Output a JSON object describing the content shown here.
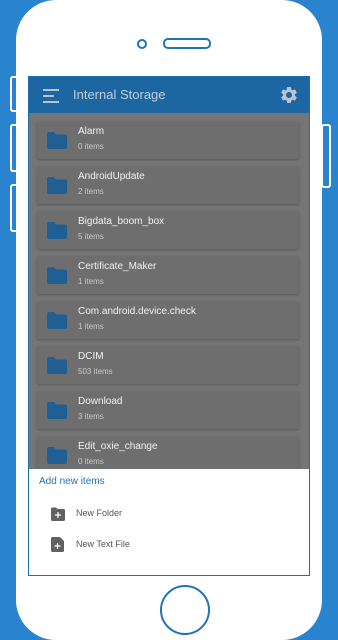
{
  "app": {
    "title": "Internal Storage"
  },
  "folders": [
    {
      "name": "Alarm",
      "count": "0 items"
    },
    {
      "name": "AndroidUpdate",
      "count": "2 items"
    },
    {
      "name": "Bigdata_boom_box",
      "count": "5 items"
    },
    {
      "name": "Certificate_Maker",
      "count": "1 items"
    },
    {
      "name": "Com.android.device.check",
      "count": "1 items"
    },
    {
      "name": "DCIM",
      "count": "503 items"
    },
    {
      "name": "Download",
      "count": "3 items"
    },
    {
      "name": "Edit_oxie_change",
      "count": "0 items"
    }
  ],
  "sheet": {
    "title": "Add new items",
    "items": [
      {
        "label": "New Folder",
        "icon": "new-folder-icon"
      },
      {
        "label": "New Text File",
        "icon": "new-text-file-icon"
      }
    ]
  },
  "colors": {
    "background": "#2a83cf",
    "appbar": "#1c66a2",
    "folder_icon": "#1f5f94",
    "accent": "#1f73b8"
  }
}
